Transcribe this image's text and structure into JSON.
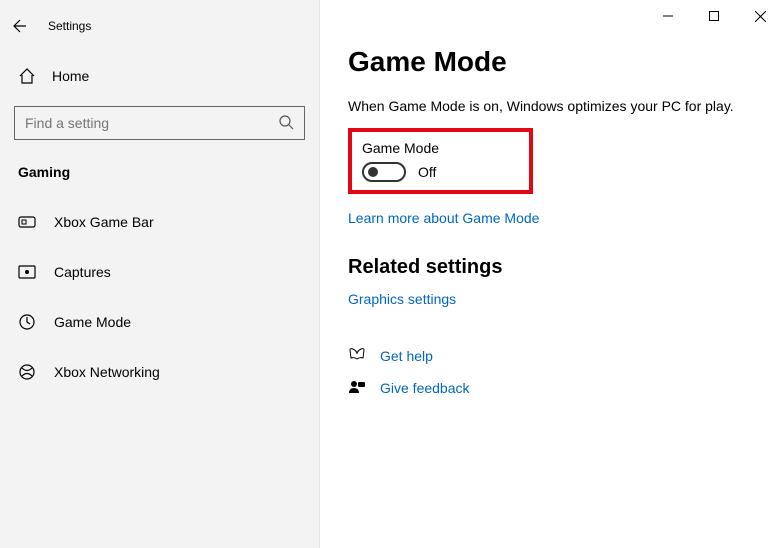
{
  "titlebar": {
    "app_title": "Settings"
  },
  "sidebar": {
    "home_label": "Home",
    "search_placeholder": "Find a setting",
    "section": "Gaming",
    "items": [
      {
        "label": "Xbox Game Bar"
      },
      {
        "label": "Captures"
      },
      {
        "label": "Game Mode"
      },
      {
        "label": "Xbox Networking"
      }
    ]
  },
  "main": {
    "title": "Game Mode",
    "description": "When Game Mode is on, Windows optimizes your PC for play.",
    "toggle_label": "Game Mode",
    "toggle_state": "Off",
    "learn_more": "Learn more about Game Mode",
    "related_heading": "Related settings",
    "graphics_link": "Graphics settings",
    "help_link": "Get help",
    "feedback_link": "Give feedback"
  }
}
